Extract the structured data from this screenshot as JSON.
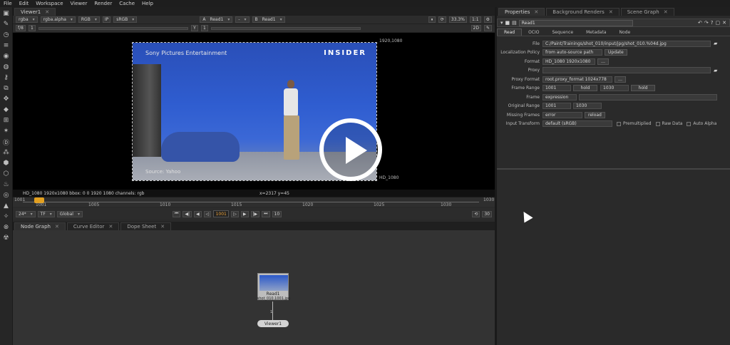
{
  "menu": [
    "File",
    "Edit",
    "Workspace",
    "Viewer",
    "Render",
    "Cache",
    "Help"
  ],
  "viewer": {
    "tab_label": "Viewer1",
    "channel_sel": "rgba",
    "alpha_sel": "rgba.alpha",
    "rgb_sel": "RGB",
    "ip_label": "IP",
    "lut_sel": "sRGB",
    "input_a": "Read1",
    "input_b": "Read1",
    "a_label": "A",
    "b_label": "B",
    "dash": "-",
    "fstop": "f/8",
    "fstop_val": "1",
    "y_label": "Y",
    "y_val": "1",
    "zoom": "33.3%",
    "ratio": "1:1",
    "view_mode": "2D"
  },
  "image": {
    "watermark_top": "Sony Pictures Entertainment",
    "watermark_bottom": "Source: Yahoo",
    "brand": "INSIDER",
    "corner_tr": "1920,1080",
    "corner_br": "HD_1080"
  },
  "infobar": {
    "format": "HD_1080 1920x1080  bbox: 0 0 1920 1080 channels: rgb",
    "coords": "x=2317 y=45"
  },
  "timeline": {
    "start": "1001",
    "end": "1030",
    "current": "1001",
    "ticks": [
      "1001",
      "1005",
      "1010",
      "1015",
      "1020",
      "1025",
      "1030"
    ]
  },
  "playback": {
    "fps": "24*",
    "tf": "TF",
    "global": "Global",
    "frame": "1001",
    "inc": "10",
    "end_frame": "30"
  },
  "bottom_tabs": [
    "Node Graph",
    "Curve Editor",
    "Dope Sheet"
  ],
  "nodes": {
    "read_name": "Read1",
    "read_file": "shot_010.1001.jpg",
    "wire_label": "1",
    "viewer_name": "Viewer1"
  },
  "properties": {
    "tabs": [
      "Properties",
      "Background Renders",
      "Scene Graph"
    ],
    "node_name": "Read1",
    "subtabs": [
      "Read",
      "OCIO",
      "Sequence",
      "Metadata",
      "Node"
    ],
    "file_label": "File",
    "file_value": "C:/Paint/Trainings/shot_010/input/jpg/shot_010.%04d.jpg",
    "localization_label": "Localization Policy",
    "localization_value": "from auto-source path",
    "localization_btn": "Update",
    "format_label": "Format",
    "format_value": "HD_1080 1920x1080",
    "proxy_label": "Proxy",
    "proxy_value": "",
    "proxy_format_label": "Proxy Format",
    "proxy_format_value": "root.proxy_format 1024x778",
    "frame_range_label": "Frame Range",
    "frame_range_start": "1001",
    "frame_range_start_mode": "hold",
    "frame_range_end": "1030",
    "frame_range_end_mode": "hold",
    "frame_label": "Frame",
    "frame_value": "expression",
    "original_range_label": "Original Range",
    "original_range_start": "1001",
    "original_range_end": "1030",
    "missing_frames_label": "Missing Frames",
    "missing_frames_value": "error",
    "reload_btn": "reload",
    "input_transform_label": "Input Transform",
    "input_transform_value": "default (sRGB)",
    "premultiplied_label": "Premultiplied",
    "raw_data_label": "Raw Data",
    "auto_alpha_label": "Auto Alpha"
  },
  "colors": {
    "accent": "#e3a020",
    "blue_screen": "#2f5dd0",
    "panel": "#2a2a2a"
  }
}
